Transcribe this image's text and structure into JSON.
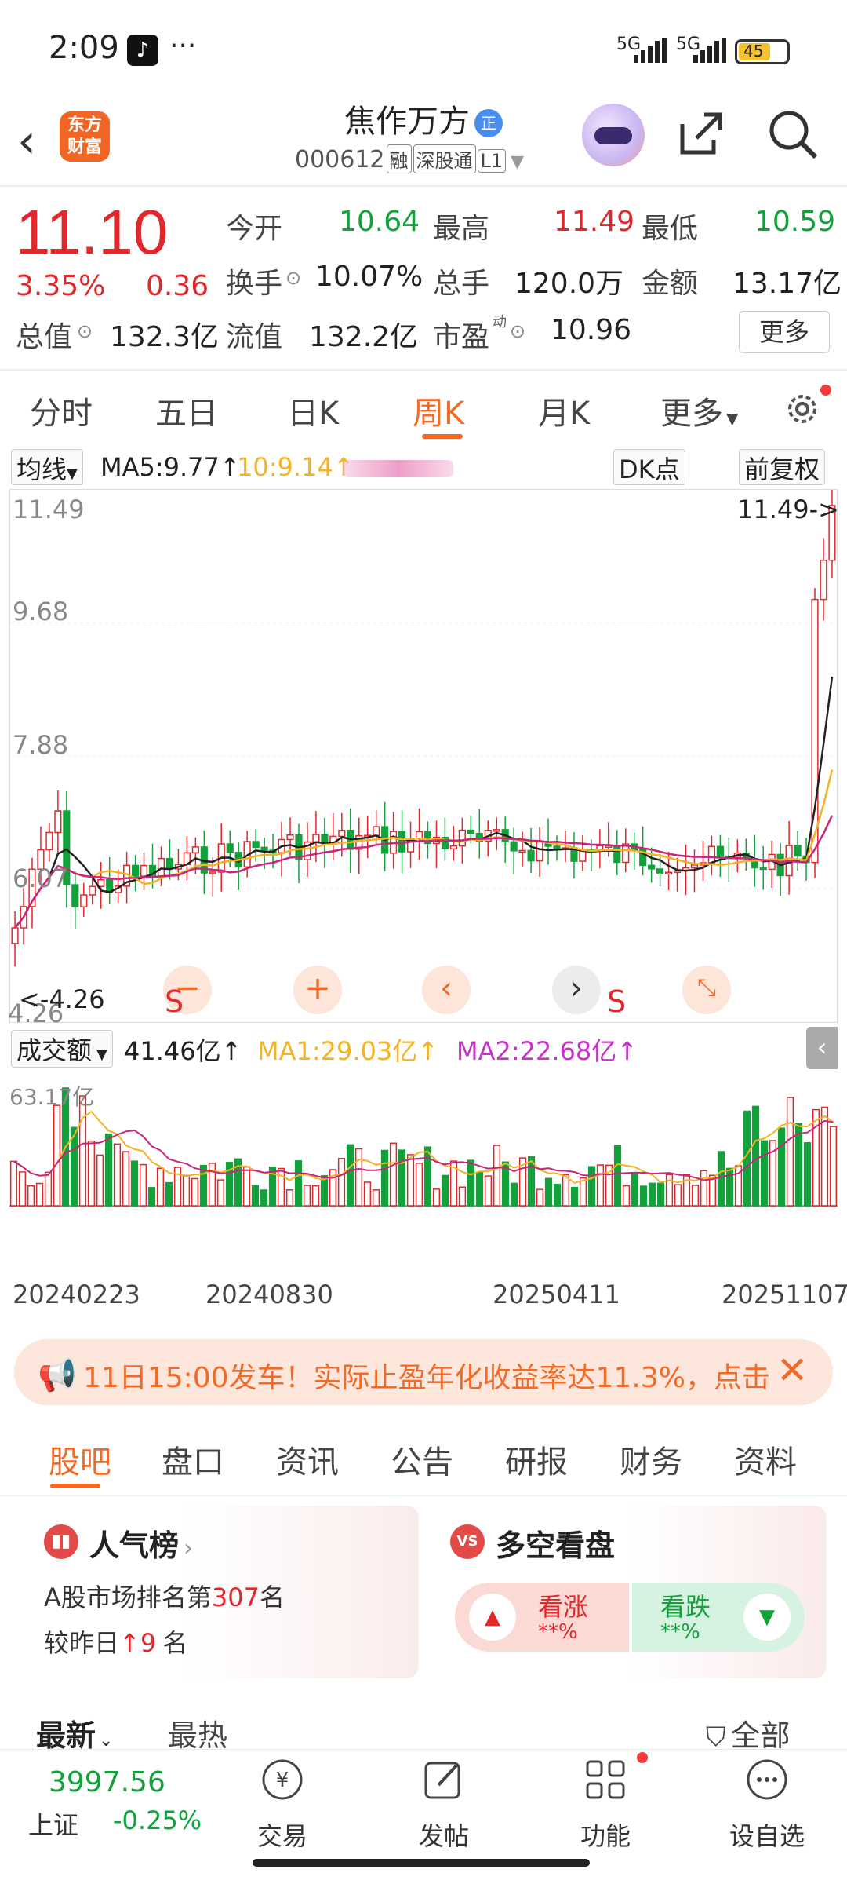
{
  "status": {
    "time": "2:09",
    "signal1": "5G",
    "signal2": "5G",
    "battery": "45"
  },
  "header": {
    "logo_text": "东方财富",
    "title": "焦作万方",
    "title_badge": "正",
    "code": "000612",
    "tags": [
      "融",
      "深股通",
      "L1"
    ]
  },
  "quote": {
    "price": "11.10",
    "change_pct": "3.35%",
    "change": "0.36",
    "open_label": "今开",
    "open": "10.64",
    "high_label": "最高",
    "high": "11.49",
    "low_label": "最低",
    "low": "10.59",
    "turnover_label": "换手",
    "turnover": "10.07%",
    "volume_label": "总手",
    "volume": "120.0万",
    "amount_label": "金额",
    "amount": "13.17亿",
    "mcap_label": "总值",
    "mcap": "132.3亿",
    "float_label": "流值",
    "float": "132.2亿",
    "pe_label": "市盈",
    "pe_sup": "动",
    "pe": "10.96",
    "more_label": "更多"
  },
  "chart_tabs": [
    "分时",
    "五日",
    "日K",
    "周K",
    "月K",
    "更多"
  ],
  "active_chart_tab": 3,
  "ma_bar": {
    "selector": "均线",
    "ma5": "MA5:9.77",
    "ma10": "10:9.14",
    "dk": "DK点",
    "adjust": "前复权"
  },
  "chart_data": {
    "type": "candlestick",
    "price_axis_labels": [
      "11.49",
      "9.68",
      "7.88",
      "6.07",
      "4.26"
    ],
    "max_marker": "11.49->",
    "min_marker": "<-4.26",
    "date_labels": [
      "20240223",
      "20240830",
      "20250411",
      "20251107"
    ],
    "colors": {
      "up": "#e2262a",
      "down": "#13a13b",
      "ma5": "#222222",
      "ma10": "#f5b324",
      "ma20": "#c8257d"
    },
    "series": [
      {
        "name": "MA5",
        "values": []
      },
      {
        "name": "MA10",
        "values": []
      }
    ]
  },
  "volume": {
    "selector": "成交额",
    "value": "41.46亿",
    "ma1": "MA1:29.03亿",
    "ma2": "MA2:22.68亿",
    "axis_top": "63.17亿"
  },
  "notice": {
    "text": "11日15:00发车！实际止盈年化收益率达11.3%，点击"
  },
  "section_tabs": [
    "股吧",
    "盘口",
    "资讯",
    "公告",
    "研报",
    "财务",
    "资料"
  ],
  "active_section_tab": 0,
  "popularity": {
    "title": "人气榜",
    "line1_prefix": "A股市场排名第",
    "rank": "307",
    "line1_suffix": "名",
    "line2_prefix": "较昨日",
    "delta": "9",
    "line2_suffix": "名"
  },
  "sentiment": {
    "title": "多空看盘",
    "bull_label": "看涨",
    "bull_value": "**%",
    "bear_label": "看跌",
    "bear_value": "**%"
  },
  "list_tabs": {
    "latest": "最新",
    "hot": "最热",
    "filter": "全部"
  },
  "bottom_nav": {
    "index_value": "3997.56",
    "index_name": "上证",
    "index_change": "-0.25%",
    "items": [
      "交易",
      "发帖",
      "功能",
      "设自选"
    ]
  }
}
